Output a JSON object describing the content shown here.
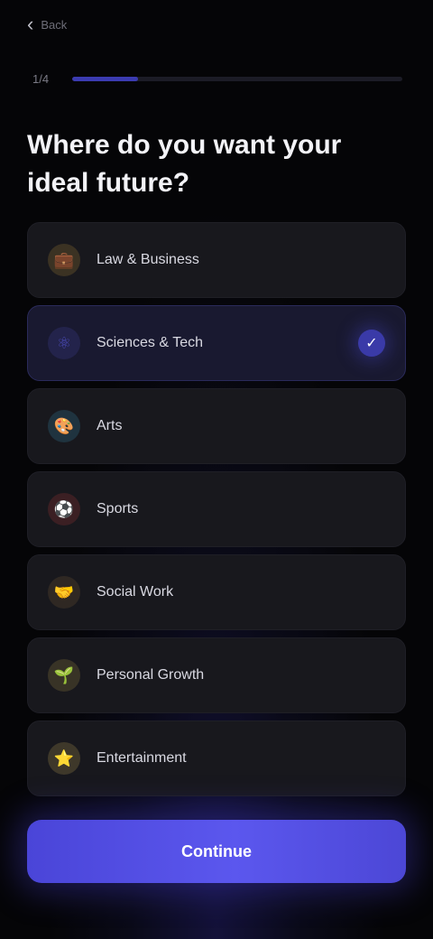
{
  "nav": {
    "back_label": "Back"
  },
  "progress": {
    "step_label": "1/4",
    "fraction": 0.2,
    "fill_color": "#3b3bb0"
  },
  "headline": "Where do you want your ideal future?",
  "options": [
    {
      "label": "Law & Business",
      "icon": "briefcase-icon",
      "glyph": "💼",
      "color": "#c79a3a",
      "selected": false
    },
    {
      "label": "Sciences & Tech",
      "icon": "atom-icon",
      "glyph": "⚛",
      "color": "#4a4ab8",
      "selected": true
    },
    {
      "label": "Arts",
      "icon": "palette-icon",
      "glyph": "🎨",
      "color": "#3aa0c8",
      "selected": false
    },
    {
      "label": "Sports",
      "icon": "ball-icon",
      "glyph": "⚽",
      "color": "#c83a3a",
      "selected": false
    },
    {
      "label": "Social Work",
      "icon": "handshake-icon",
      "glyph": "🤝",
      "color": "#8a6a3a",
      "selected": false
    },
    {
      "label": "Personal Growth",
      "icon": "sprout-icon",
      "glyph": "🌱",
      "color": "#b8a04a",
      "selected": false
    },
    {
      "label": "Entertainment",
      "icon": "star-icon",
      "glyph": "⭐",
      "color": "#d8b860",
      "selected": false
    }
  ],
  "selected_check_glyph": "✓",
  "continue_label": "Continue",
  "accent_color": "#5b57ee"
}
